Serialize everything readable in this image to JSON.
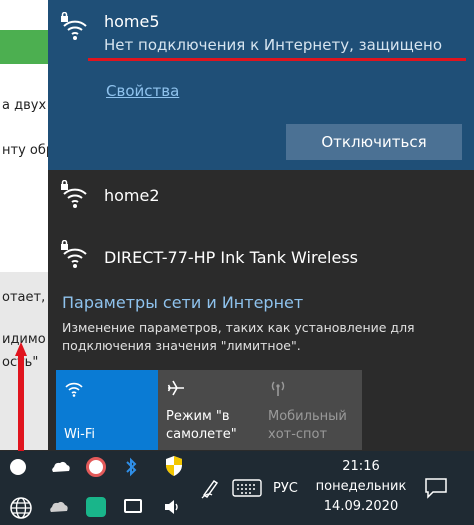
{
  "background_page": {
    "lines": [
      "а двух",
      "нту обр",
      "отает,",
      "идимо",
      "ость\""
    ]
  },
  "connected_network": {
    "name": "home5",
    "status": "Нет подключения к Интернету, защищено",
    "properties_label": "Свойства",
    "disconnect_label": "Отключиться"
  },
  "networks": [
    {
      "name": "home2"
    },
    {
      "name": "DIRECT-77-HP Ink Tank Wireless"
    }
  ],
  "settings": {
    "title": "Параметры сети и Интернет",
    "description": "Изменение параметров, таких как установление для подключения значения \"лимитное\"."
  },
  "quick_actions": {
    "wifi": "Wi-Fi",
    "airplane": "Режим \"в самолете\"",
    "hotspot": "Мобильный хот-спот"
  },
  "taskbar": {
    "language": "РУС",
    "time": "21:16",
    "weekday": "понедельник",
    "date": "14.09.2020"
  },
  "colors": {
    "accent": "#0a7bd4",
    "connected_bg": "#1f4f77",
    "flyout_bg": "#2b2b2b",
    "link": "#8fc3ee",
    "annotation_red": "#e0141e"
  }
}
